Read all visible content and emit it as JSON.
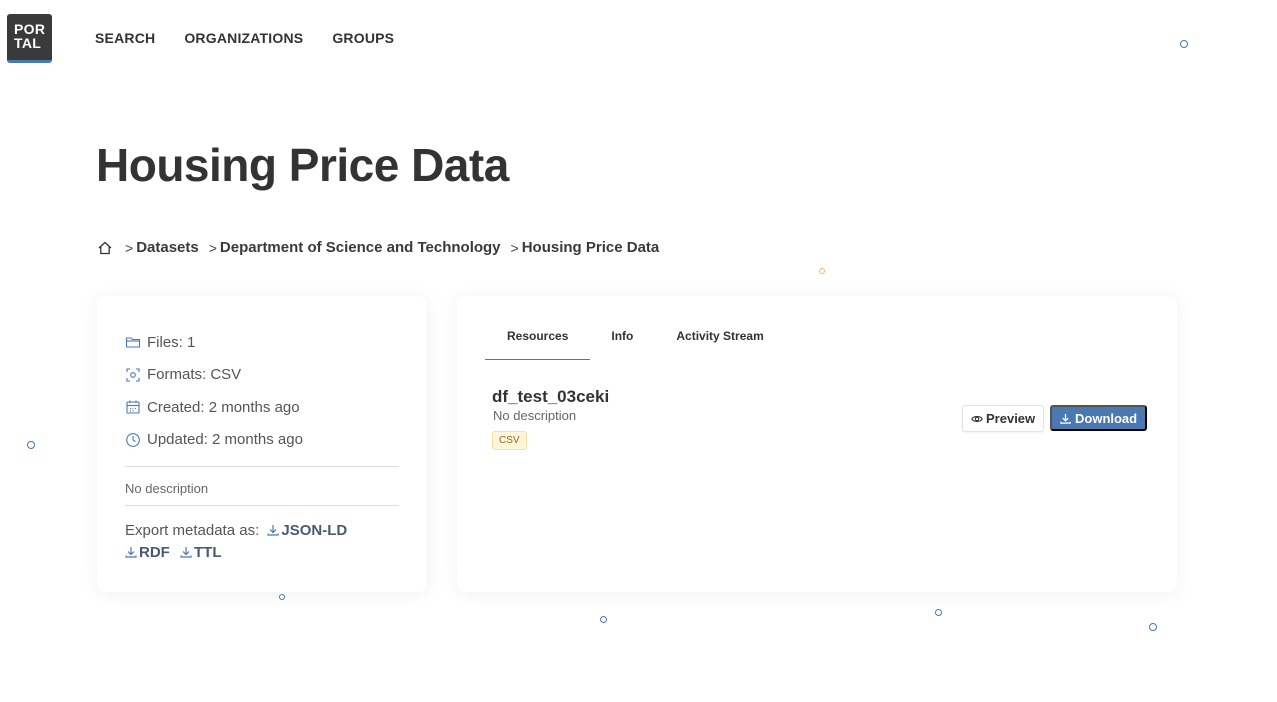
{
  "logo": {
    "line1": "POR",
    "line2": "TAL"
  },
  "nav": {
    "items": [
      "SEARCH",
      "ORGANIZATIONS",
      "GROUPS"
    ]
  },
  "page": {
    "title": "Housing Price Data"
  },
  "breadcrumb": {
    "home_icon": "home-icon",
    "items": [
      "Datasets",
      "Department of Science and Technology",
      "Housing Price Data"
    ],
    "separator": ">"
  },
  "summary": {
    "files": "Files: 1",
    "formats": "Formats: CSV",
    "created": "Created: 2 months ago",
    "updated": "Updated: 2 months ago",
    "description": "No description",
    "export_label": "Export metadata as:",
    "export_links": [
      "JSON-LD",
      "RDF",
      "TTL"
    ]
  },
  "tabs": [
    "Resources",
    "Info",
    "Activity Stream"
  ],
  "resource": {
    "name": "df_test_03ceki",
    "description": "No description",
    "format": "CSV",
    "preview_label": "Preview",
    "download_label": "Download"
  },
  "colors": {
    "accent": "#4a78b0",
    "text": "#333333",
    "badge_bg": "#fdf6d8"
  }
}
